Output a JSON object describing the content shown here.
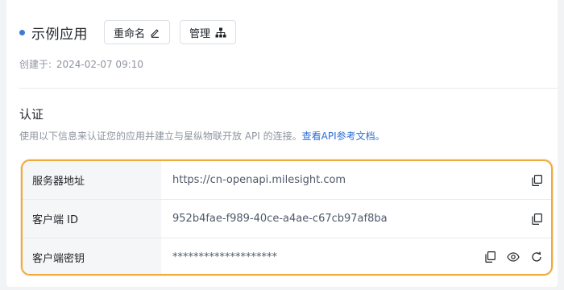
{
  "app": {
    "name": "示例应用",
    "status_color": "#3a7bd5",
    "rename_label": "重命名",
    "manage_label": "管理",
    "created_label": "创建于:",
    "created_value": "2024-02-07 09:10"
  },
  "auth": {
    "title": "认证",
    "description": "使用以下信息来认证您的应用并建立与星纵物联开放 API 的连接。",
    "doc_link": "查看API参考文档。",
    "rows": [
      {
        "label": "服务器地址",
        "value": "https://cn-openapi.milesight.com"
      },
      {
        "label": "客户端 ID",
        "value": "952b4fae-f989-40ce-a4ae-c67cb97af8ba"
      },
      {
        "label": "客户端密钥",
        "value": "********************"
      }
    ]
  },
  "colors": {
    "accent": "#2e6fd6",
    "highlight_border": "#f0a93b"
  },
  "icons": [
    "pencil-icon",
    "sitemap-icon",
    "copy-icon",
    "eye-icon",
    "refresh-icon"
  ]
}
